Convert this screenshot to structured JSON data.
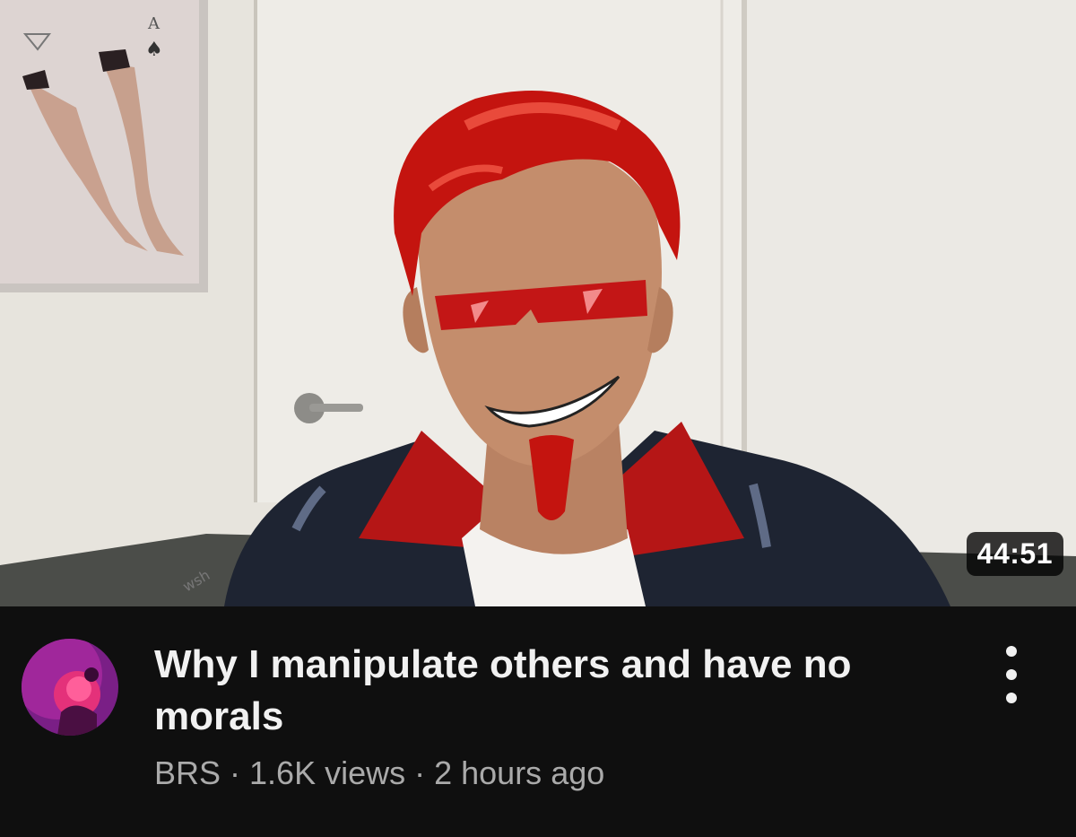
{
  "video": {
    "duration": "44:51",
    "title": "Why I manipulate others and have no morals",
    "channel": "BRS",
    "views": "1.6K views",
    "age": "2 hours ago",
    "separator": "·"
  },
  "icons": {
    "more": "more-vert-icon"
  },
  "colors": {
    "background": "#0f0f0f",
    "title": "#f1f1f1",
    "subtext": "#aaaaaa",
    "avatar_accent": "#e4317a"
  }
}
